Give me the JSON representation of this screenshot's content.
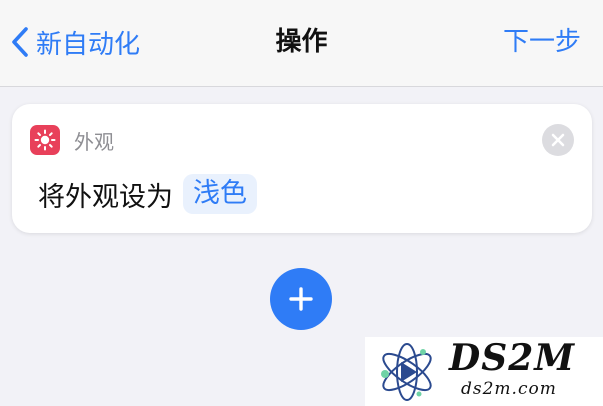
{
  "navbar": {
    "back_label": "新自动化",
    "title": "操作",
    "next_label": "下一步"
  },
  "action_card": {
    "app_name": "外观",
    "app_icon": "sun-icon",
    "action_text": "将外观设为",
    "parameter_value": "浅色"
  },
  "watermark": {
    "brand": "DS2M",
    "url": "ds2m.com"
  },
  "colors": {
    "accent": "#2f7cf6",
    "app_icon_bg": "#e8405a",
    "background": "#f2f2f7"
  }
}
